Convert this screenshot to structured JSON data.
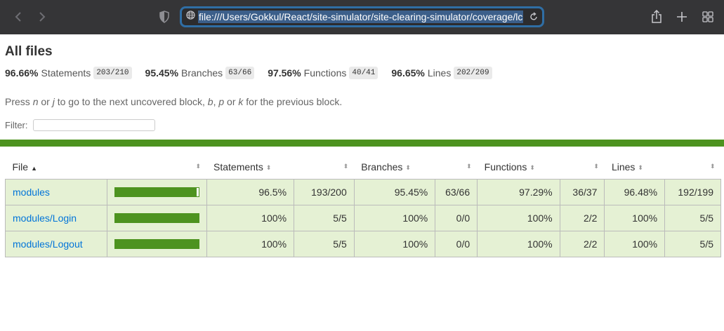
{
  "browser": {
    "url": "file:///Users/Gokkul/React/site-simulator/site-clearing-simulator/coverage/lco",
    "icons": [
      "back-icon",
      "forward-icon",
      "shield-icon",
      "globe-icon",
      "reload-icon",
      "share-icon",
      "plus-icon",
      "tabs-grid-icon"
    ]
  },
  "page": {
    "title": "All files",
    "summary": [
      {
        "pct": "96.66%",
        "label": "Statements",
        "frac": "203/210"
      },
      {
        "pct": "95.45%",
        "label": "Branches",
        "frac": "63/66"
      },
      {
        "pct": "97.56%",
        "label": "Functions",
        "frac": "40/41"
      },
      {
        "pct": "96.65%",
        "label": "Lines",
        "frac": "202/209"
      }
    ],
    "hint": {
      "p1": "Press ",
      "n": "n",
      "p2": " or ",
      "j": "j",
      "p3": " to go to the next uncovered block, ",
      "b": "b",
      "p4": ", ",
      "p": "p",
      "p5": " or ",
      "k": "k",
      "p6": " for the previous block."
    },
    "filter_label": "Filter:",
    "filter_value": ""
  },
  "table": {
    "headers": [
      "File",
      "",
      "Statements",
      "",
      "Branches",
      "",
      "Functions",
      "",
      "Lines",
      ""
    ],
    "rows": [
      {
        "file": "modules",
        "coverage": 0.965,
        "stmt_pct": "96.5%",
        "stmt": "193/200",
        "br_pct": "95.45%",
        "br": "63/66",
        "fn_pct": "97.29%",
        "fn": "36/37",
        "ln_pct": "96.48%",
        "ln": "192/199"
      },
      {
        "file": "modules/Login",
        "coverage": 1.0,
        "stmt_pct": "100%",
        "stmt": "5/5",
        "br_pct": "100%",
        "br": "0/0",
        "fn_pct": "100%",
        "fn": "2/2",
        "ln_pct": "100%",
        "ln": "5/5"
      },
      {
        "file": "modules/Logout",
        "coverage": 1.0,
        "stmt_pct": "100%",
        "stmt": "5/5",
        "br_pct": "100%",
        "br": "0/0",
        "fn_pct": "100%",
        "fn": "2/2",
        "ln_pct": "100%",
        "ln": "5/5"
      }
    ]
  },
  "colors": {
    "accent_green": "#4d931f",
    "row_high_bg": "#e5f1d4",
    "link": "#0074d9"
  }
}
